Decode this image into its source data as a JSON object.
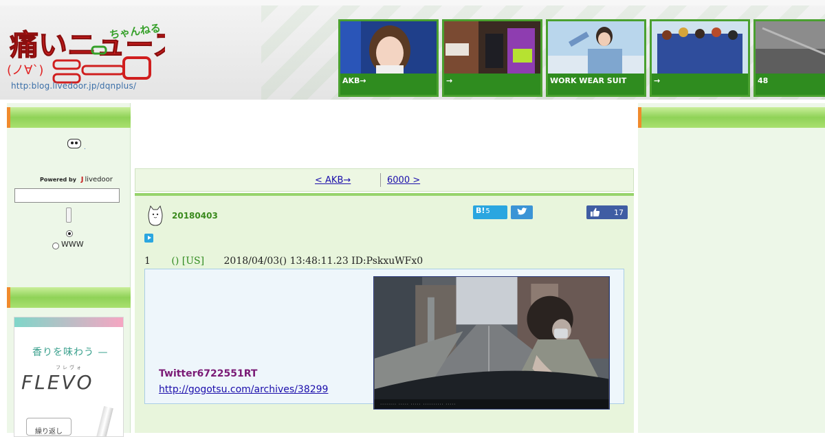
{
  "header": {
    "logo_url": "http:blog.livedoor.jp/dqnplus/",
    "logo_main": "痛いニュース",
    "logo_face": "(ノ∀`)",
    "logo_sub": "ちゃんねる",
    "thumbnails": [
      {
        "caption": "AKB→"
      },
      {
        "caption": "→"
      },
      {
        "caption": "WORK WEAR SUIT"
      },
      {
        "caption": "→"
      },
      {
        "caption": "48"
      }
    ]
  },
  "sidebar_left": {
    "powered_label": "Powered by",
    "powered_brand": "livedoor",
    "mini_text": ".",
    "search_value": "",
    "radio_www": "WWW",
    "ad": {
      "headline": "香りを味わう —",
      "furigana": "フレヴォ",
      "brand": "FLEVO",
      "button": "繰り返し"
    }
  },
  "nav": {
    "prev": "< AKB→",
    "next": "6000 >"
  },
  "post": {
    "date": "20180403",
    "hatena_label": "B!",
    "hatena_count": "5",
    "like_count": "17",
    "res_number": "1",
    "res_name": "() [US]",
    "res_meta": "2018/04/03() 13:48:11.23 ID:PskxuWFx0",
    "twitter_text": "Twitter6722551RT",
    "link": "http://gogotsu.com/archives/38299"
  },
  "colors": {
    "accent_green": "#2f8c1f",
    "bar_orange": "#f08a2c",
    "link_blue": "#1a0dab"
  }
}
